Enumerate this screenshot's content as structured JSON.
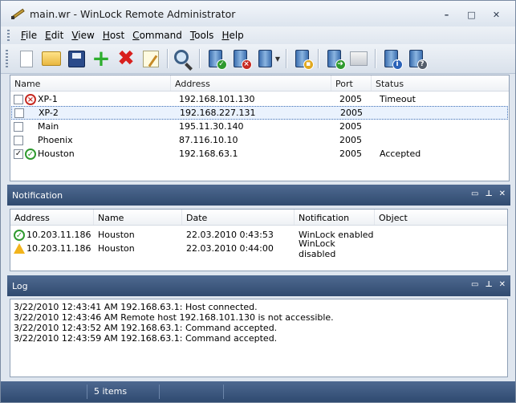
{
  "window": {
    "title": "main.wr - WinLock Remote Administrator",
    "controls": [
      "–",
      "□",
      "✕"
    ]
  },
  "menu": [
    "File",
    "Edit",
    "View",
    "Host",
    "Command",
    "Tools",
    "Help"
  ],
  "toolbar": {
    "buttons": [
      "new-document",
      "open-folder",
      "save-disk",
      "add-host",
      "delete-host",
      "edit-properties",
      "find",
      "host-connect",
      "host-disconnect",
      "host-actions",
      "host-lock",
      "host-refresh",
      "host-print",
      "host-info",
      "host-help"
    ]
  },
  "hosts": {
    "columns": [
      "Name",
      "Address",
      "Port",
      "Status"
    ],
    "rows": [
      {
        "checked": false,
        "status_icon": "error",
        "name": "XP-1",
        "address": "192.168.101.130",
        "port": "2005",
        "status": "Timeout"
      },
      {
        "checked": false,
        "status_icon": "none",
        "name": "XP-2",
        "address": "192.168.227.131",
        "port": "2005",
        "status": ""
      },
      {
        "checked": false,
        "status_icon": "none",
        "name": "Main",
        "address": "195.11.30.140",
        "port": "2005",
        "status": ""
      },
      {
        "checked": false,
        "status_icon": "none",
        "name": "Phoenix",
        "address": "87.116.10.10",
        "port": "2005",
        "status": ""
      },
      {
        "checked": true,
        "status_icon": "ok",
        "name": "Houston",
        "address": "192.168.63.1",
        "port": "2005",
        "status": "Accepted"
      }
    ]
  },
  "notification": {
    "title": "Notification",
    "columns": [
      "Address",
      "Name",
      "Date",
      "Notification",
      "Object"
    ],
    "rows": [
      {
        "icon": "ok",
        "address": "10.203.11.186",
        "name": "Houston",
        "date": "22.03.2010 0:43:53",
        "notification": "WinLock enabled",
        "object": ""
      },
      {
        "icon": "warning",
        "address": "10.203.11.186",
        "name": "Houston",
        "date": "22.03.2010 0:44:00",
        "notification": "WinLock disabled",
        "object": ""
      }
    ]
  },
  "log": {
    "title": "Log",
    "lines": [
      "3/22/2010 12:43:41 AM 192.168.63.1: Host connected.",
      "3/22/2010 12:43:46 AM Remote host 192.168.101.130 is not accessible.",
      "3/22/2010 12:43:52 AM 192.168.63.1: Command accepted.",
      "3/22/2010 12:43:59 AM 192.168.63.1: Command accepted."
    ]
  },
  "statusbar": {
    "items_count": "5 items"
  }
}
